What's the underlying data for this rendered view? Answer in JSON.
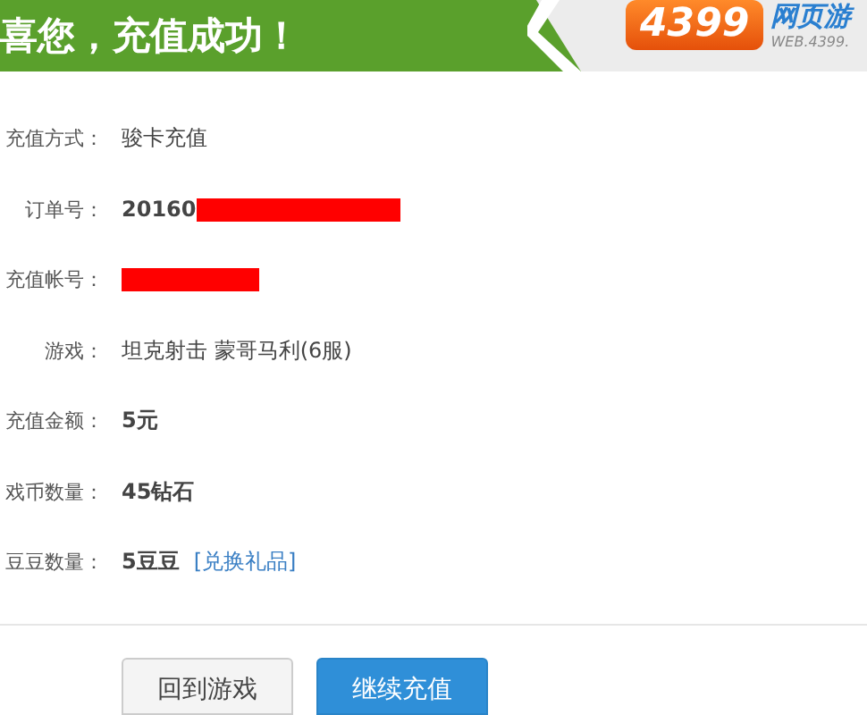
{
  "header": {
    "title": "喜您，充值成功！",
    "logo": {
      "badge": "4399",
      "name": "网页游",
      "url": "WEB.4399."
    }
  },
  "rows": [
    {
      "label": "充值方式：",
      "value": "骏卡充值",
      "bold": false,
      "redacted": false
    },
    {
      "label": "订单号：",
      "value": "20160",
      "bold": true,
      "redacted": true
    },
    {
      "label": "充值帐号：",
      "redacted": true
    },
    {
      "label": "游戏：",
      "value": "坦克射击 蒙哥马利(6服)",
      "bold": false,
      "redacted": false
    },
    {
      "label": "充值金额：",
      "value": "5元",
      "bold": true,
      "redacted": false
    },
    {
      "label": "戏币数量：",
      "value": "45钻石",
      "bold": true,
      "redacted": false
    },
    {
      "label": "豆豆数量：",
      "value": "5豆豆",
      "bold": true,
      "redacted": false,
      "link": "[兑换礼品]"
    }
  ],
  "buttons": [
    {
      "label": "回到游戏",
      "kind": "secondary"
    },
    {
      "label": "继续充值",
      "kind": "primary"
    }
  ]
}
